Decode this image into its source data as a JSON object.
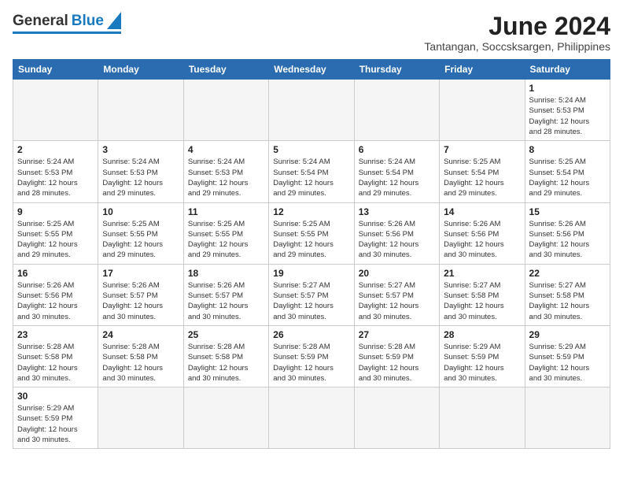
{
  "header": {
    "logo_text_general": "General",
    "logo_text_blue": "Blue",
    "main_title": "June 2024",
    "subtitle": "Tantangan, Soccsksargen, Philippines"
  },
  "calendar": {
    "days_of_week": [
      "Sunday",
      "Monday",
      "Tuesday",
      "Wednesday",
      "Thursday",
      "Friday",
      "Saturday"
    ],
    "weeks": [
      [
        {
          "day": "",
          "info": "",
          "empty": true
        },
        {
          "day": "",
          "info": "",
          "empty": true
        },
        {
          "day": "",
          "info": "",
          "empty": true
        },
        {
          "day": "",
          "info": "",
          "empty": true
        },
        {
          "day": "",
          "info": "",
          "empty": true
        },
        {
          "day": "",
          "info": "",
          "empty": true
        },
        {
          "day": "1",
          "info": "Sunrise: 5:24 AM\nSunset: 5:53 PM\nDaylight: 12 hours\nand 28 minutes."
        }
      ],
      [
        {
          "day": "2",
          "info": "Sunrise: 5:24 AM\nSunset: 5:53 PM\nDaylight: 12 hours\nand 28 minutes."
        },
        {
          "day": "3",
          "info": "Sunrise: 5:24 AM\nSunset: 5:53 PM\nDaylight: 12 hours\nand 29 minutes."
        },
        {
          "day": "4",
          "info": "Sunrise: 5:24 AM\nSunset: 5:53 PM\nDaylight: 12 hours\nand 29 minutes."
        },
        {
          "day": "5",
          "info": "Sunrise: 5:24 AM\nSunset: 5:54 PM\nDaylight: 12 hours\nand 29 minutes."
        },
        {
          "day": "6",
          "info": "Sunrise: 5:24 AM\nSunset: 5:54 PM\nDaylight: 12 hours\nand 29 minutes."
        },
        {
          "day": "7",
          "info": "Sunrise: 5:25 AM\nSunset: 5:54 PM\nDaylight: 12 hours\nand 29 minutes."
        },
        {
          "day": "8",
          "info": "Sunrise: 5:25 AM\nSunset: 5:54 PM\nDaylight: 12 hours\nand 29 minutes."
        }
      ],
      [
        {
          "day": "9",
          "info": "Sunrise: 5:25 AM\nSunset: 5:55 PM\nDaylight: 12 hours\nand 29 minutes."
        },
        {
          "day": "10",
          "info": "Sunrise: 5:25 AM\nSunset: 5:55 PM\nDaylight: 12 hours\nand 29 minutes."
        },
        {
          "day": "11",
          "info": "Sunrise: 5:25 AM\nSunset: 5:55 PM\nDaylight: 12 hours\nand 29 minutes."
        },
        {
          "day": "12",
          "info": "Sunrise: 5:25 AM\nSunset: 5:55 PM\nDaylight: 12 hours\nand 29 minutes."
        },
        {
          "day": "13",
          "info": "Sunrise: 5:26 AM\nSunset: 5:56 PM\nDaylight: 12 hours\nand 30 minutes."
        },
        {
          "day": "14",
          "info": "Sunrise: 5:26 AM\nSunset: 5:56 PM\nDaylight: 12 hours\nand 30 minutes."
        },
        {
          "day": "15",
          "info": "Sunrise: 5:26 AM\nSunset: 5:56 PM\nDaylight: 12 hours\nand 30 minutes."
        }
      ],
      [
        {
          "day": "16",
          "info": "Sunrise: 5:26 AM\nSunset: 5:56 PM\nDaylight: 12 hours\nand 30 minutes."
        },
        {
          "day": "17",
          "info": "Sunrise: 5:26 AM\nSunset: 5:57 PM\nDaylight: 12 hours\nand 30 minutes."
        },
        {
          "day": "18",
          "info": "Sunrise: 5:26 AM\nSunset: 5:57 PM\nDaylight: 12 hours\nand 30 minutes."
        },
        {
          "day": "19",
          "info": "Sunrise: 5:27 AM\nSunset: 5:57 PM\nDaylight: 12 hours\nand 30 minutes."
        },
        {
          "day": "20",
          "info": "Sunrise: 5:27 AM\nSunset: 5:57 PM\nDaylight: 12 hours\nand 30 minutes."
        },
        {
          "day": "21",
          "info": "Sunrise: 5:27 AM\nSunset: 5:58 PM\nDaylight: 12 hours\nand 30 minutes."
        },
        {
          "day": "22",
          "info": "Sunrise: 5:27 AM\nSunset: 5:58 PM\nDaylight: 12 hours\nand 30 minutes."
        }
      ],
      [
        {
          "day": "23",
          "info": "Sunrise: 5:28 AM\nSunset: 5:58 PM\nDaylight: 12 hours\nand 30 minutes."
        },
        {
          "day": "24",
          "info": "Sunrise: 5:28 AM\nSunset: 5:58 PM\nDaylight: 12 hours\nand 30 minutes."
        },
        {
          "day": "25",
          "info": "Sunrise: 5:28 AM\nSunset: 5:58 PM\nDaylight: 12 hours\nand 30 minutes."
        },
        {
          "day": "26",
          "info": "Sunrise: 5:28 AM\nSunset: 5:59 PM\nDaylight: 12 hours\nand 30 minutes."
        },
        {
          "day": "27",
          "info": "Sunrise: 5:28 AM\nSunset: 5:59 PM\nDaylight: 12 hours\nand 30 minutes."
        },
        {
          "day": "28",
          "info": "Sunrise: 5:29 AM\nSunset: 5:59 PM\nDaylight: 12 hours\nand 30 minutes."
        },
        {
          "day": "29",
          "info": "Sunrise: 5:29 AM\nSunset: 5:59 PM\nDaylight: 12 hours\nand 30 minutes."
        }
      ],
      [
        {
          "day": "30",
          "info": "Sunrise: 5:29 AM\nSunset: 5:59 PM\nDaylight: 12 hours\nand 30 minutes."
        },
        {
          "day": "",
          "info": "",
          "empty": true
        },
        {
          "day": "",
          "info": "",
          "empty": true
        },
        {
          "day": "",
          "info": "",
          "empty": true
        },
        {
          "day": "",
          "info": "",
          "empty": true
        },
        {
          "day": "",
          "info": "",
          "empty": true
        },
        {
          "day": "",
          "info": "",
          "empty": true
        }
      ]
    ]
  }
}
